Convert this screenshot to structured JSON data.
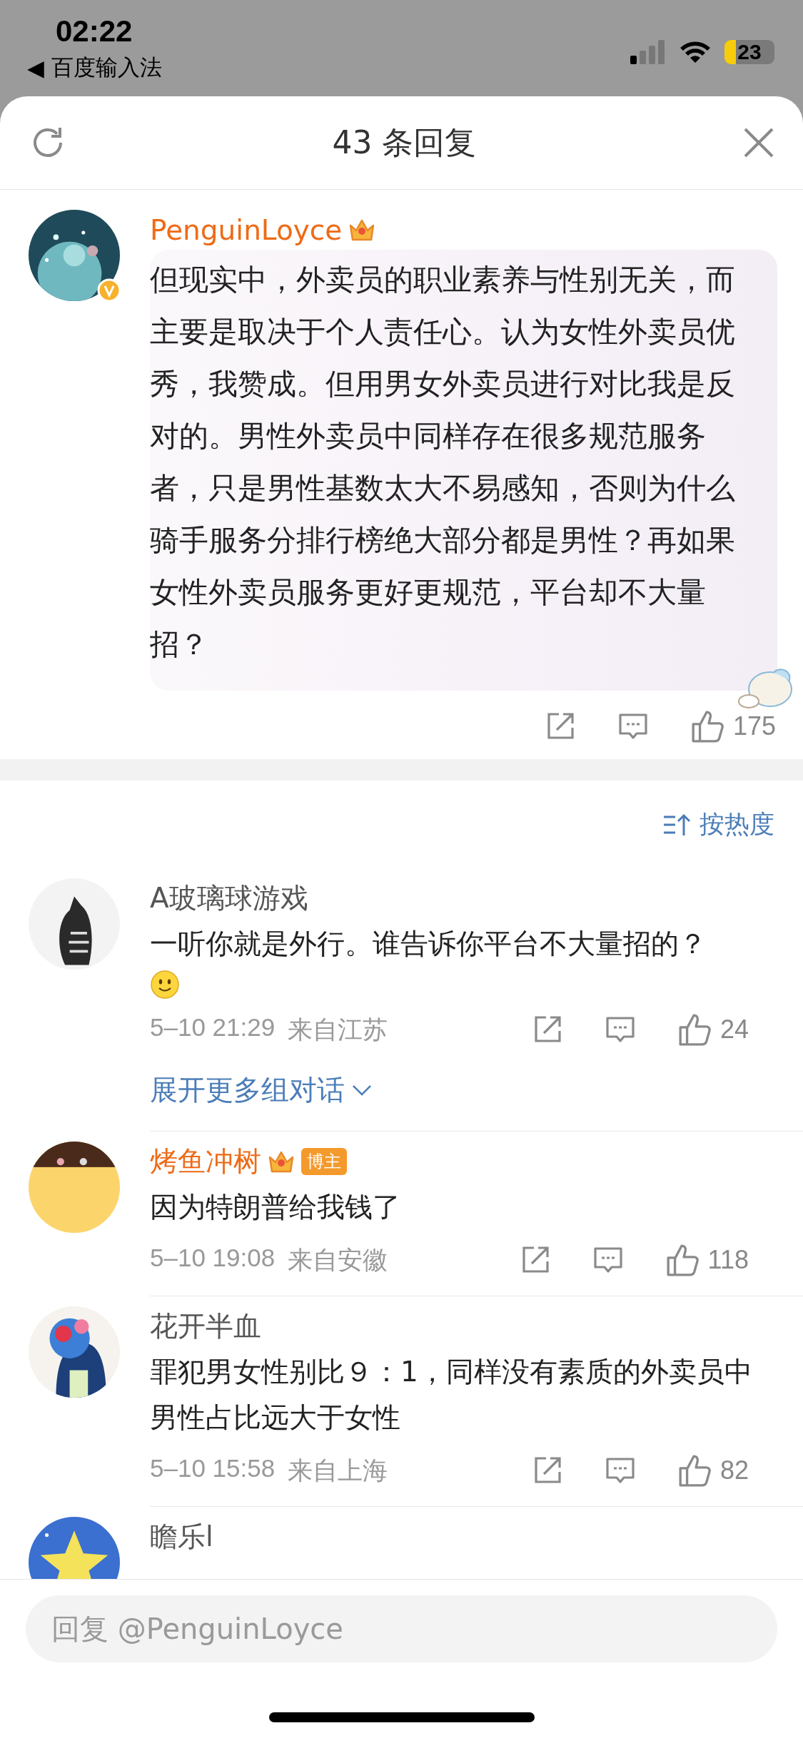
{
  "status_bar": {
    "time": "02:22",
    "back_arrow": "◀",
    "back_app": "百度输入法",
    "battery": "23"
  },
  "header": {
    "title": "43 条回复"
  },
  "root_comment": {
    "user": "PenguinLoyce",
    "member": true,
    "verified": true,
    "text": "但现实中，外卖员的职业素养与性别无关，而主要是取决于个人责任心。认为女性外卖员优秀，我赞成。但用男女外卖员进行对比我是反对的。男性外卖员中同样存在很多规范服务者，只是男性基数太大不易感知，否则为什么骑手服务分排行榜绝大部分都是男性？再如果女性外卖员服务更好更规范，平台却不大量招？",
    "likes": "175"
  },
  "sort": {
    "label": "按热度"
  },
  "replies": [
    {
      "user": "A玻璃球游戏",
      "member": false,
      "text": "一听你就是外行。谁告诉你平台不大量招的？",
      "emoji": true,
      "time": "5–10 21:29",
      "location": "来自江苏",
      "likes": "24",
      "more": "展开更多组对话"
    },
    {
      "user": "烤鱼冲树",
      "member": true,
      "badge": "博主",
      "text": "因为特朗普给我钱了",
      "emoji": false,
      "time": "5–10 19:08",
      "location": "来自安徽",
      "likes": "118"
    },
    {
      "user": "花开半血",
      "member": false,
      "text": "罪犯男女性别比９：1，同样没有素质的外卖员中男性占比远大于女性",
      "emoji": false,
      "time": "5–10 15:58",
      "location": "来自上海",
      "likes": "82"
    },
    {
      "user": "瞻乐l",
      "member": false
    }
  ],
  "reply_field": {
    "placeholder": "回复 @PenguinLoyce"
  }
}
